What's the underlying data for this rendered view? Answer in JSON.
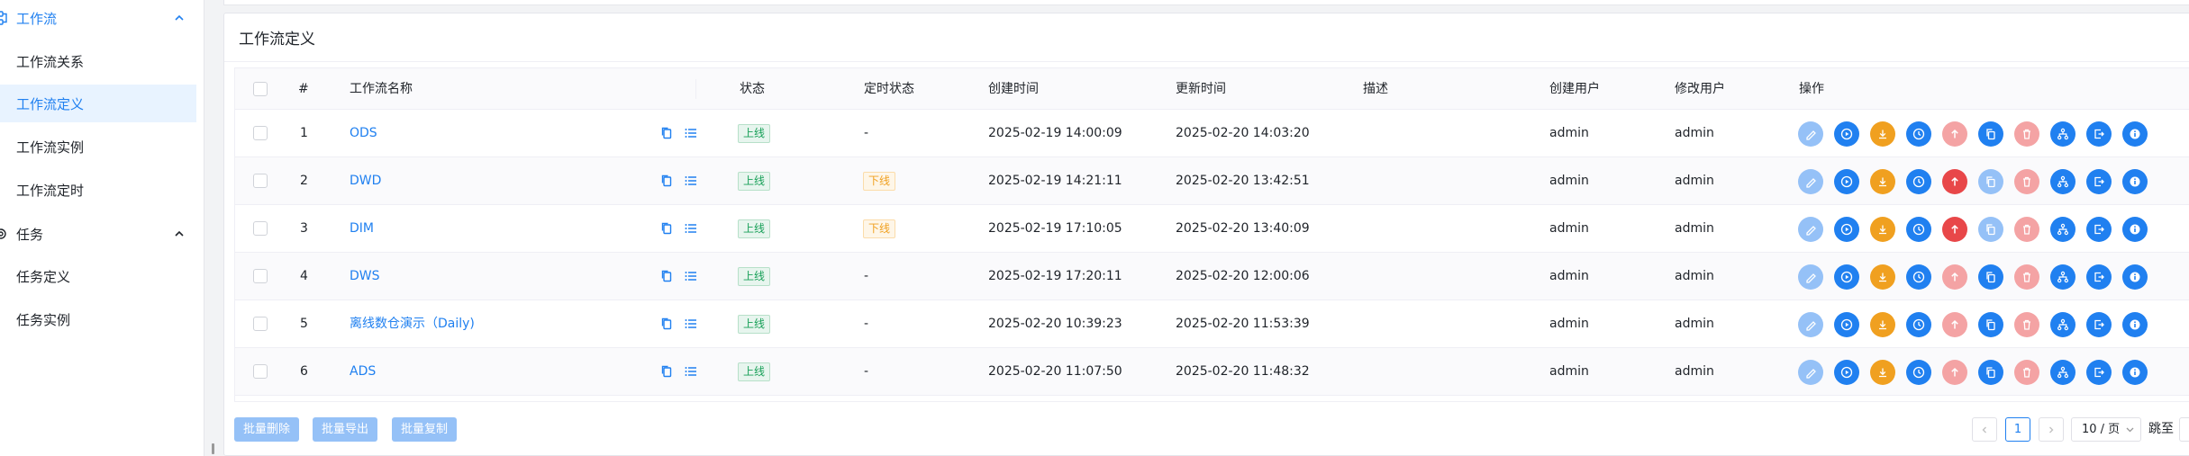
{
  "sidebar": {
    "groups": [
      {
        "label": "工作流",
        "items": [
          "工作流关系",
          "工作流定义",
          "工作流实例",
          "工作流定时"
        ]
      },
      {
        "label": "任务",
        "items": [
          "任务定义",
          "任务实例"
        ]
      }
    ],
    "active_item": "工作流定义"
  },
  "card": {
    "title": "工作流定义"
  },
  "table": {
    "headers": {
      "index": "#",
      "name": "工作流名称",
      "status": "状态",
      "schedule_status": "定时状态",
      "created": "创建时间",
      "updated": "更新时间",
      "description": "描述",
      "creator": "创建用户",
      "modifier": "修改用户",
      "actions": "操作"
    },
    "rows": [
      {
        "index": "1",
        "name": "ODS",
        "status": "上线",
        "schedule": "-",
        "created": "2025-02-19 14:00:09",
        "updated": "2025-02-20 14:03:20",
        "description": "",
        "creator": "admin",
        "modifier": "admin"
      },
      {
        "index": "2",
        "name": "DWD",
        "status": "上线",
        "schedule": "下线",
        "created": "2025-02-19 14:21:11",
        "updated": "2025-02-20 13:42:51",
        "description": "",
        "creator": "admin",
        "modifier": "admin"
      },
      {
        "index": "3",
        "name": "DIM",
        "status": "上线",
        "schedule": "下线",
        "created": "2025-02-19 17:10:05",
        "updated": "2025-02-20 13:40:09",
        "description": "",
        "creator": "admin",
        "modifier": "admin"
      },
      {
        "index": "4",
        "name": "DWS",
        "status": "上线",
        "schedule": "-",
        "created": "2025-02-19 17:20:11",
        "updated": "2025-02-20 12:00:06",
        "description": "",
        "creator": "admin",
        "modifier": "admin"
      },
      {
        "index": "5",
        "name": "离线数仓演示（Daily)",
        "status": "上线",
        "schedule": "-",
        "created": "2025-02-20 10:39:23",
        "updated": "2025-02-20 11:53:39",
        "description": "",
        "creator": "admin",
        "modifier": "admin"
      },
      {
        "index": "6",
        "name": "ADS",
        "status": "上线",
        "schedule": "-",
        "created": "2025-02-20 11:07:50",
        "updated": "2025-02-20 11:48:32",
        "description": "",
        "creator": "admin",
        "modifier": "admin"
      }
    ],
    "action_icons": [
      "edit-icon",
      "run-icon",
      "download-icon",
      "timer-icon",
      "publish-icon",
      "copy-icon",
      "delete-icon",
      "tree-icon",
      "export-icon",
      "info-icon"
    ]
  },
  "footer": {
    "batch_delete": "批量删除",
    "batch_export": "批量导出",
    "batch_copy": "批量复制",
    "current_page": "1",
    "page_size": "10 / 页",
    "jump_label": "跳至"
  },
  "colors": {
    "primary": "#2080f0",
    "primary_light": "#95c1f7",
    "warning": "#f0a020",
    "error": "#e84749",
    "error_light": "#f4a3a4",
    "success": "#18a058"
  }
}
